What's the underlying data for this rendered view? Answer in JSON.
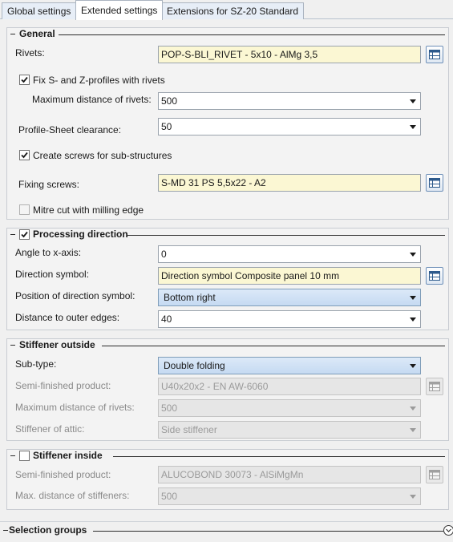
{
  "tabs": [
    {
      "label": "Global settings",
      "active": false
    },
    {
      "label": "Extended settings",
      "active": true
    },
    {
      "label": "Extensions for SZ-20 Standard",
      "active": false
    }
  ],
  "general": {
    "title": "General",
    "rivets_label": "Rivets:",
    "rivets_value": "POP-S-BLI_RIVET -  5x10 - AlMg 3,5",
    "fix_profiles_label": "Fix S- and Z-profiles with rivets",
    "fix_profiles_checked": true,
    "max_distance_label": "Maximum distance of rivets:",
    "max_distance_value": "500",
    "clearance_label": "Profile-Sheet clearance:",
    "clearance_value": "50",
    "create_screws_label": "Create screws for sub-structures",
    "create_screws_checked": true,
    "fixing_screws_label": "Fixing screws:",
    "fixing_screws_value": "S-MD 31 PS 5,5x22 - A2",
    "mitre_label": "Mitre cut with milling edge",
    "mitre_checked": false
  },
  "processing": {
    "title": "Processing direction",
    "checked": true,
    "angle_label": "Angle to x-axis:",
    "angle_value": "0",
    "symbol_label": "Direction symbol:",
    "symbol_value": "Direction symbol Composite panel 10 mm",
    "position_label": "Position of direction symbol:",
    "position_value": "Bottom right",
    "distance_label": "Distance to outer edges:",
    "distance_value": "40"
  },
  "stiffener_outside": {
    "title": "Stiffener outside",
    "subtype_label": "Sub-type:",
    "subtype_value": "Double folding",
    "semi_label": "Semi-finished product:",
    "semi_value": "U40x20x2 - EN AW-6060",
    "max_rivets_label": "Maximum distance of rivets:",
    "max_rivets_value": "500",
    "attic_label": "Stiffener of attic:",
    "attic_value": "Side stiffener"
  },
  "stiffener_inside": {
    "title": "Stiffener inside",
    "checked": false,
    "semi_label": "Semi-finished product:",
    "semi_value": "ALUCOBOND 30073 - AlSiMgMn",
    "max_label": "Max. distance of stiffeners:",
    "max_value": "500"
  },
  "selection_groups": {
    "title": "Selection groups"
  },
  "icons": {
    "picker": "table-picker-icon",
    "check": "check-icon",
    "dropdown": "chevron-down-icon",
    "collapse": "collapse-icon"
  }
}
